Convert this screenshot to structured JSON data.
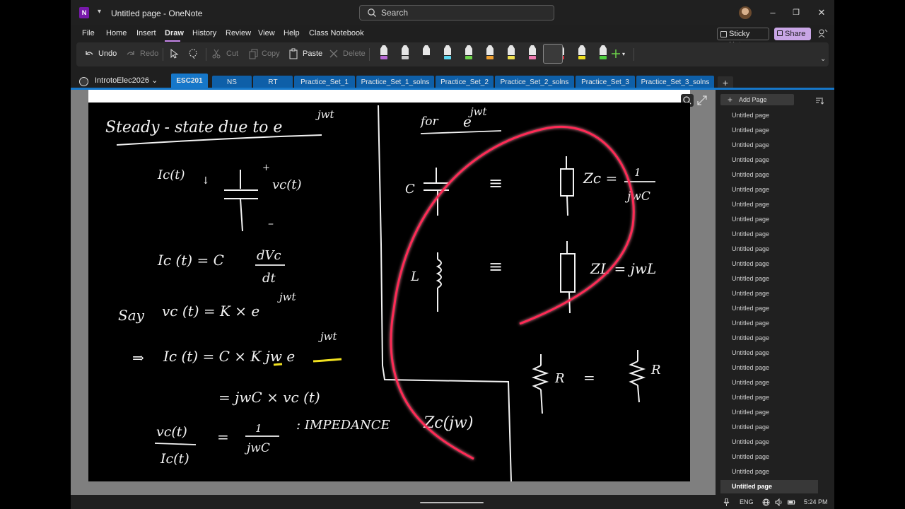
{
  "titlebar": {
    "app_logo": "N",
    "doc_title": "Untitled page - OneNote",
    "search_placeholder": "Search",
    "min": "–",
    "restore": "❐",
    "close": "✕"
  },
  "menu": [
    "File",
    "Home",
    "Insert",
    "Draw",
    "History",
    "Review",
    "View",
    "Help",
    "Class Notebook"
  ],
  "menu_active": "Draw",
  "sticky_notes": "Sticky Notes",
  "share": "Share",
  "ribbon": {
    "undo": "Undo",
    "redo": "Redo",
    "cut": "Cut",
    "copy": "Copy",
    "paste": "Paste",
    "delete": "Delete",
    "pens": [
      {
        "name": "purple-pen",
        "color": "#b86ad6"
      },
      {
        "name": "ink-pen",
        "color": "#cccccc"
      },
      {
        "name": "black-pen",
        "color": "#222222"
      },
      {
        "name": "light-blue-pen",
        "color": "#5ad6f0"
      },
      {
        "name": "green-pen",
        "color": "#6dd24a"
      },
      {
        "name": "orange-pen",
        "color": "#f0a030"
      },
      {
        "name": "yellow-pen",
        "color": "#f0e050"
      },
      {
        "name": "pink-pen",
        "color": "#f07ab0"
      },
      {
        "name": "red-pen",
        "color": "#e03040"
      },
      {
        "name": "yellow-highlighter",
        "color": "#f0e020"
      },
      {
        "name": "green-highlighter",
        "color": "#50d040"
      }
    ]
  },
  "notebook": "IntrotoElec2026",
  "sections": [
    "ESC201",
    "NS",
    "RT",
    "Practice_Set_1",
    "Practice_Set_1_solns",
    "Practice_Set_2",
    "Practice_Set_2_solns",
    "Practice_Set_3",
    "Practice_Set_3_solns"
  ],
  "active_section": "ESC201",
  "add_section": "+",
  "pages": {
    "add_page": "Add Page",
    "items": [
      "Untitled page",
      "Untitled page",
      "Untitled page",
      "Untitled page",
      "Untitled page",
      "Untitled page",
      "Untitled page",
      "Untitled page",
      "Untitled page",
      "Untitled page",
      "Untitled page",
      "Untitled page",
      "Untitled page",
      "Untitled page",
      "Untitled page",
      "Untitled page",
      "Untitled page",
      "Untitled page",
      "Untitled page",
      "Untitled page",
      "Untitled page",
      "Untitled page",
      "Untitled page",
      "Untitled page",
      "Untitled page",
      "Untitled page"
    ],
    "active_index": 25
  },
  "ink": {
    "heading": "Steady - state due to e",
    "heading_exp": "jwt",
    "ic_label": "Ic(t)",
    "plus": "+",
    "minus": "–",
    "vc_label": "vc(t)",
    "eq1_lhs": "Ic (t) = C",
    "eq1_num": "dVc",
    "eq1_den": "dt",
    "say": "Say",
    "eq2": "vc (t) = K × e",
    "eq2_exp": "jwt",
    "implies": "⇒",
    "eq3": "Ic (t) = C × K jw e",
    "eq3_exp": "jwt",
    "eq4": "= jwC × vc (t)",
    "frac_num": "vc(t)",
    "frac_den": "Ic(t)",
    "eq5_eq": "=",
    "eq5_num": "1",
    "eq5_den": "jwC",
    "impedance": ": IMPEDANCE",
    "zc_jw": "Zc(jw)",
    "for": "for",
    "for_e": "e",
    "for_exp": "jwt",
    "c_label": "C",
    "equiv": "≡",
    "zc": "Zc =",
    "zc_num": "1",
    "zc_den": "jwC",
    "l_label": "L",
    "zl": "ZL = jwL",
    "r_label": "R",
    "r_eq": "="
  },
  "status": {
    "lang": "ENG",
    "time": "5:24 PM"
  },
  "colors": {
    "section_tab": "#0e5fa8",
    "section_tab_active": "#1677c9",
    "share_bg": "#c9a6e6",
    "annotation_stroke": "#ff2a55"
  }
}
